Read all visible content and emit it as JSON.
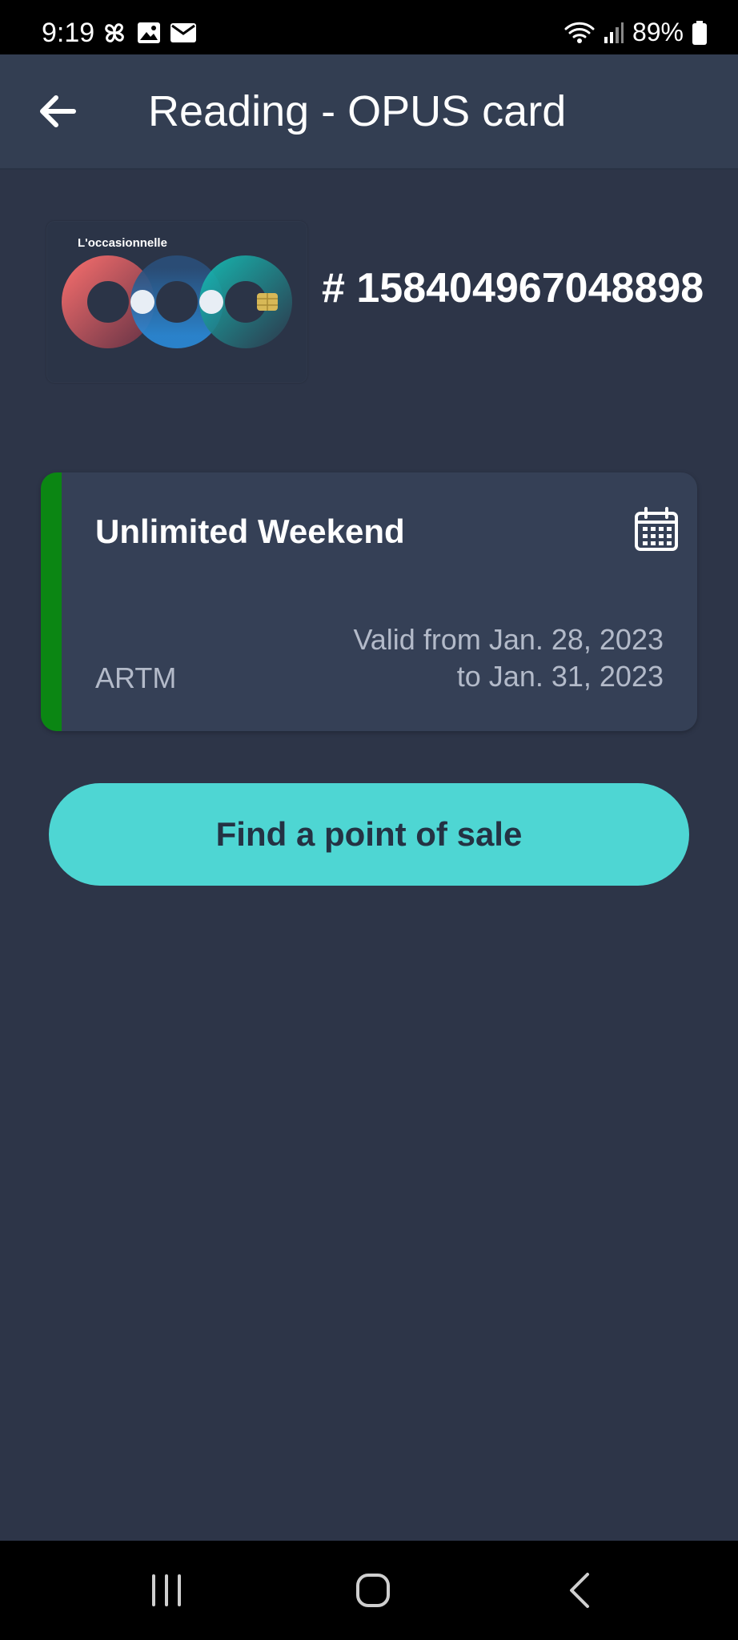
{
  "status_bar": {
    "time": "9:19",
    "battery": "89%",
    "icons_left": [
      "pinwheel-icon",
      "gallery-icon",
      "mail-icon"
    ],
    "icons_right": [
      "wifi-icon",
      "signal-icon",
      "battery-icon"
    ]
  },
  "app_bar": {
    "title": "Reading - OPUS card",
    "back_icon": "arrow-left-icon"
  },
  "card": {
    "name": "L'occasionnelle",
    "number": "# 158404967048898"
  },
  "fare": {
    "title": "Unlimited Weekend",
    "operator": "ARTM",
    "valid_from": "Valid from Jan. 28, 2023",
    "valid_to": "to Jan. 31, 2023",
    "icon": "calendar-icon",
    "status_color": "#0b8613"
  },
  "actions": {
    "find_point_of_sale": "Find a point of sale"
  },
  "colors": {
    "background": "#2d3548",
    "app_bar": "#333e52",
    "card": "#354056",
    "accent": "#4ed6d3"
  },
  "nav_bar": {
    "buttons": [
      "recent-apps-icon",
      "home-icon",
      "back-icon"
    ]
  }
}
